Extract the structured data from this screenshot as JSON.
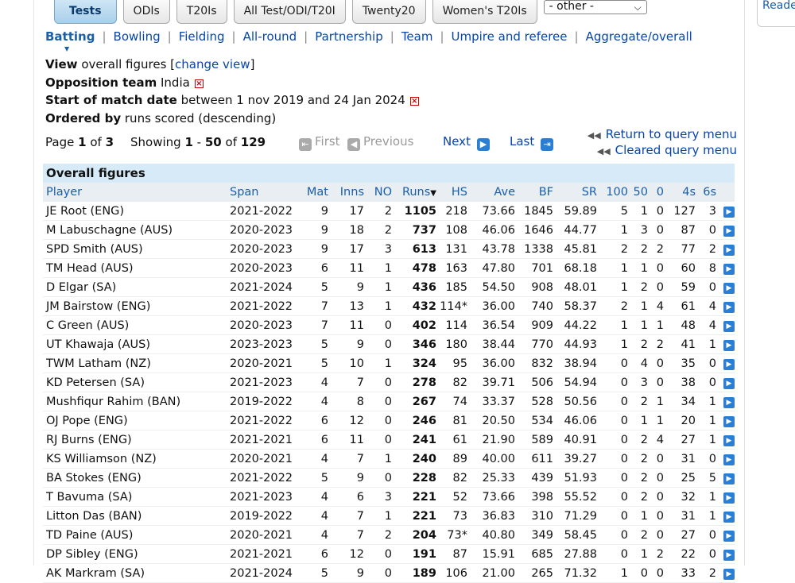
{
  "tabs": [
    {
      "label": "Tests",
      "active": true
    },
    {
      "label": "ODIs",
      "active": false
    },
    {
      "label": "T20Is",
      "active": false
    },
    {
      "label": "All Test/ODI/T20I",
      "active": false
    },
    {
      "label": "Twenty20",
      "active": false
    },
    {
      "label": "Women's T20Is",
      "active": false
    }
  ],
  "other_select": {
    "value": "- other -"
  },
  "reader": "Reader",
  "subnav": [
    "Batting",
    "Bowling",
    "Fielding",
    "All-round",
    "Partnership",
    "Team",
    "Umpire and referee",
    "Aggregate/overall"
  ],
  "filters": {
    "view_label": "View",
    "view_text": "overall figures [",
    "change_view": "change view",
    "view_end": "]",
    "opp_label": "Opposition team",
    "opp_value": "India",
    "date_label": "Start of match date",
    "date_value": "between 1 nov 2019 and 24 Jan 2024",
    "order_label": "Ordered by",
    "order_value": "runs scored (descending)"
  },
  "pager": {
    "page_prefix": "Page",
    "page": "1",
    "of": "of",
    "pages": "3",
    "showing": "Showing",
    "range_start": "1",
    "dash": "-",
    "range_end": "50",
    "of2": "of",
    "total": "129",
    "first": "First",
    "previous": "Previous",
    "next": "Next",
    "last": "Last",
    "return_query": "Return to query menu",
    "cleared_query": "Cleared query menu"
  },
  "table": {
    "caption": "Overall figures",
    "columns": [
      "Player",
      "Span",
      "Mat",
      "Inns",
      "NO",
      "Runs",
      "HS",
      "Ave",
      "BF",
      "SR",
      "100",
      "50",
      "0",
      "4s",
      "6s"
    ],
    "rows": [
      [
        "JE Root (ENG)",
        "2021-2022",
        "9",
        "17",
        "2",
        "1105",
        "218",
        "73.66",
        "1845",
        "59.89",
        "5",
        "1",
        "0",
        "127",
        "3"
      ],
      [
        "M Labuschagne (AUS)",
        "2020-2023",
        "9",
        "18",
        "2",
        "737",
        "108",
        "46.06",
        "1646",
        "44.77",
        "1",
        "3",
        "0",
        "87",
        "0"
      ],
      [
        "SPD Smith (AUS)",
        "2020-2023",
        "9",
        "17",
        "3",
        "613",
        "131",
        "43.78",
        "1338",
        "45.81",
        "2",
        "2",
        "2",
        "77",
        "2"
      ],
      [
        "TM Head (AUS)",
        "2020-2023",
        "6",
        "11",
        "1",
        "478",
        "163",
        "47.80",
        "701",
        "68.18",
        "1",
        "1",
        "0",
        "60",
        "8"
      ],
      [
        "D Elgar (SA)",
        "2021-2024",
        "5",
        "9",
        "1",
        "436",
        "185",
        "54.50",
        "908",
        "48.01",
        "1",
        "2",
        "0",
        "59",
        "0"
      ],
      [
        "JM Bairstow (ENG)",
        "2021-2022",
        "7",
        "13",
        "1",
        "432",
        "114*",
        "36.00",
        "740",
        "58.37",
        "2",
        "1",
        "4",
        "61",
        "4"
      ],
      [
        "C Green (AUS)",
        "2020-2023",
        "7",
        "11",
        "0",
        "402",
        "114",
        "36.54",
        "909",
        "44.22",
        "1",
        "1",
        "1",
        "48",
        "4"
      ],
      [
        "UT Khawaja (AUS)",
        "2023-2023",
        "5",
        "9",
        "0",
        "346",
        "180",
        "38.44",
        "770",
        "44.93",
        "1",
        "2",
        "2",
        "41",
        "1"
      ],
      [
        "TWM Latham (NZ)",
        "2020-2021",
        "5",
        "10",
        "1",
        "324",
        "95",
        "36.00",
        "832",
        "38.94",
        "0",
        "4",
        "0",
        "35",
        "0"
      ],
      [
        "KD Petersen (SA)",
        "2021-2023",
        "4",
        "7",
        "0",
        "278",
        "82",
        "39.71",
        "506",
        "54.94",
        "0",
        "3",
        "0",
        "38",
        "0"
      ],
      [
        "Mushfiqur Rahim (BAN)",
        "2019-2022",
        "4",
        "8",
        "0",
        "267",
        "74",
        "33.37",
        "528",
        "50.56",
        "0",
        "2",
        "1",
        "34",
        "1"
      ],
      [
        "OJ Pope (ENG)",
        "2021-2022",
        "6",
        "12",
        "0",
        "246",
        "81",
        "20.50",
        "534",
        "46.06",
        "0",
        "1",
        "1",
        "20",
        "1"
      ],
      [
        "RJ Burns (ENG)",
        "2021-2021",
        "6",
        "11",
        "0",
        "241",
        "61",
        "21.90",
        "589",
        "40.91",
        "0",
        "2",
        "4",
        "27",
        "1"
      ],
      [
        "KS Williamson (NZ)",
        "2020-2021",
        "4",
        "7",
        "1",
        "240",
        "89",
        "40.00",
        "611",
        "39.27",
        "0",
        "2",
        "0",
        "31",
        "0"
      ],
      [
        "BA Stokes (ENG)",
        "2021-2022",
        "5",
        "9",
        "0",
        "228",
        "82",
        "25.33",
        "439",
        "51.93",
        "0",
        "2",
        "0",
        "25",
        "5"
      ],
      [
        "T Bavuma (SA)",
        "2021-2023",
        "4",
        "6",
        "3",
        "221",
        "52",
        "73.66",
        "398",
        "55.52",
        "0",
        "2",
        "0",
        "32",
        "1"
      ],
      [
        "Litton Das (BAN)",
        "2019-2022",
        "4",
        "7",
        "1",
        "221",
        "73",
        "36.83",
        "310",
        "71.29",
        "0",
        "1",
        "0",
        "31",
        "1"
      ],
      [
        "TD Paine (AUS)",
        "2020-2021",
        "4",
        "7",
        "2",
        "204",
        "73*",
        "40.80",
        "349",
        "58.45",
        "0",
        "2",
        "0",
        "27",
        "0"
      ],
      [
        "DP Sibley (ENG)",
        "2021-2021",
        "6",
        "12",
        "0",
        "191",
        "87",
        "15.91",
        "685",
        "27.88",
        "0",
        "1",
        "2",
        "22",
        "0"
      ],
      [
        "AK Markram (SA)",
        "2021-2024",
        "5",
        "9",
        "0",
        "189",
        "106",
        "21.00",
        "265",
        "71.32",
        "1",
        "0",
        "0",
        "33",
        "2"
      ]
    ]
  }
}
